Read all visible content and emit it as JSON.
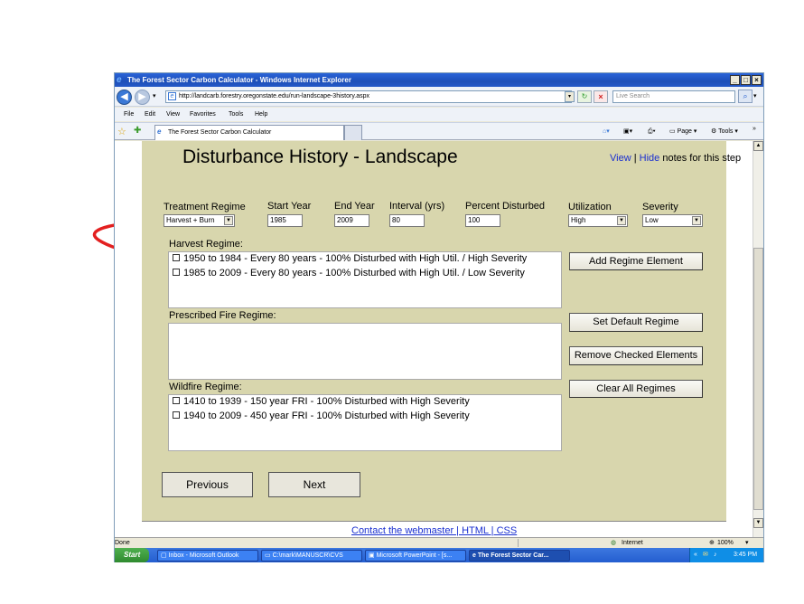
{
  "window": {
    "title": "The Forest Sector Carbon Calculator - Windows Internet Explorer",
    "controls": [
      "_",
      "□",
      "×"
    ]
  },
  "address_bar": {
    "url": "http://landcarb.forestry.oregonstate.edu/run-landscape-3history.aspx",
    "search_placeholder": "Live Search"
  },
  "menu": [
    "File",
    "Edit",
    "View",
    "Favorites",
    "Tools",
    "Help"
  ],
  "tab": {
    "label": "The Forest Sector Carbon Calculator"
  },
  "command_bar": {
    "page": "Page",
    "tools": "Tools"
  },
  "page": {
    "heading": "Disturbance History - Landscape",
    "view_link": "View",
    "separator": "|",
    "hide_link": "Hide",
    "notes_text": "notes for this step",
    "form": {
      "treatment_regime": {
        "label": "Treatment Regime",
        "value": "Harvest + Burn"
      },
      "start_year": {
        "label": "Start Year",
        "value": "1985"
      },
      "end_year": {
        "label": "End Year",
        "value": "2009"
      },
      "interval": {
        "label": "Interval (yrs)",
        "value": "80"
      },
      "percent_disturbed": {
        "label": "Percent Disturbed",
        "value": "100"
      },
      "utilization": {
        "label": "Utilization",
        "value": "High"
      },
      "severity": {
        "label": "Severity",
        "value": "Low"
      }
    },
    "harvest": {
      "title": "Harvest Regime:",
      "entries": [
        "1950 to 1984 - Every 80 years - 100% Disturbed with High Util. / High Severity",
        "1985 to 2009 - Every 80 years - 100% Disturbed with High Util. / Low Severity"
      ]
    },
    "fire": {
      "title": "Prescribed Fire Regime:",
      "entries": []
    },
    "wildfire": {
      "title": "Wildfire Regime:",
      "entries": [
        "1410 to 1939 - 150 year FRI - 100% Disturbed with High Severity",
        "1940 to 2009 - 450 year FRI - 100% Disturbed with High Severity"
      ]
    },
    "buttons": {
      "add": "Add Regime Element",
      "set_default": "Set Default Regime",
      "remove_checked": "Remove Checked Elements",
      "clear_all": "Clear All Regimes",
      "previous": "Previous",
      "next": "Next"
    },
    "footer_link": "Contact the webmaster | HTML | CSS"
  },
  "status_bar": {
    "left": "Done",
    "zone": "Internet",
    "zoom": "100%"
  },
  "taskbar": {
    "start": "Start",
    "items": [
      "Inbox - Microsoft Outlook",
      "C:\\mark\\MANUSCR\\CVS",
      "Microsoft PowerPoint - [s...",
      "The Forest Sector Car..."
    ],
    "time": "3:45 PM"
  },
  "colors": {
    "panel": "#d8d6ad",
    "annotation_arrow": "#e32020",
    "link": "#1a2fd0"
  }
}
